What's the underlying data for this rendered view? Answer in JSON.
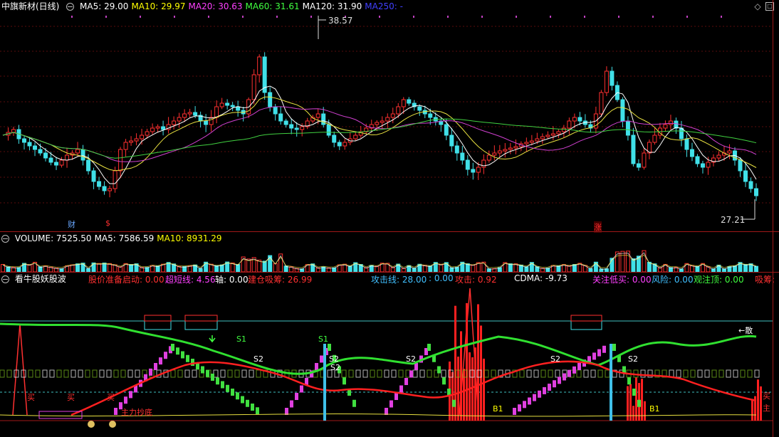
{
  "price_panel": {
    "title": "中旗新材(日线)",
    "ma_labels": [
      {
        "text": "MA5: 29.00",
        "color": "#ffffff"
      },
      {
        "text": "MA10: 29.97",
        "color": "#ffff00"
      },
      {
        "text": "MA20: 30.63",
        "color": "#ff40ff"
      },
      {
        "text": "MA60: 31.61",
        "color": "#40ff40"
      },
      {
        "text": "MA120: 31.90",
        "color": "#ffffff"
      },
      {
        "text": "MA250: -",
        "color": "#4040ff"
      }
    ],
    "high_label": "38.57",
    "low_label": "27.21",
    "markers": [
      {
        "text": "财",
        "color": "#6aa8ff"
      },
      {
        "text": "$",
        "color": "#ff3030"
      },
      {
        "text": "涨",
        "color": "#ff3030"
      }
    ]
  },
  "volume_panel": {
    "labels": [
      {
        "text": "VOLUME: 7525.50",
        "color": "#ffffff"
      },
      {
        "text": "MA5: 7586.59",
        "color": "#ffffff"
      },
      {
        "text": "MA10: 8931.29",
        "color": "#ffff00"
      }
    ]
  },
  "indicator_panel": {
    "title": "看牛股妖股波",
    "labels": [
      {
        "text": "股价准备启动: 0.00",
        "color": "#ff3030"
      },
      {
        "text": "超短线: 4.56",
        "color": "#ff40ff"
      },
      {
        "text": "轴: 0.00",
        "color": "#ffffff"
      },
      {
        "text": "建仓吸筹: 26.99",
        "color": "#ff3030"
      },
      {
        "text": "攻击线: 28.00",
        "color": "#40c0ff"
      },
      {
        "text": ": 0.00",
        "color": "#40c0ff"
      },
      {
        "text": "攻击: 0.92",
        "color": "#ff3030"
      },
      {
        "text": "CDMA: -9.73",
        "color": "#ffffff"
      },
      {
        "text": "关注低买: 0.00",
        "color": "#ff40ff"
      },
      {
        "text": "风险: 0.00",
        "color": "#40c0ff"
      },
      {
        "text": "观注顶: 0.00",
        "color": "#40ff40"
      },
      {
        "text": "吸筹:",
        "color": "#ff3030"
      }
    ],
    "chart_annotations": [
      {
        "text": "S1",
        "color": "#40ff40"
      },
      {
        "text": "S1",
        "color": "#40ff40"
      },
      {
        "text": "S2",
        "color": "#ffffff"
      },
      {
        "text": "S2",
        "color": "#ffffff"
      },
      {
        "text": "S2",
        "color": "#ffffff"
      },
      {
        "text": "S2",
        "color": "#ffffff"
      },
      {
        "text": "S2",
        "color": "#ffffff"
      },
      {
        "text": "S2",
        "color": "#ffffff"
      },
      {
        "text": "B1",
        "color": "#ffff00"
      },
      {
        "text": "B1",
        "color": "#ffff00"
      },
      {
        "text": "←散",
        "color": "#ffffff"
      },
      {
        "text": "买",
        "color": "#ff3030"
      },
      {
        "text": "主",
        "color": "#ff3030"
      },
      {
        "text": "买",
        "color": "#ff3030"
      },
      {
        "text": "买",
        "color": "#ff3030"
      },
      {
        "text": "买",
        "color": "#ff3030"
      },
      {
        "text": "主力抄底",
        "color": "#ff3030"
      }
    ]
  },
  "icons": {
    "diamond": "diamond-icon",
    "expand": "maximize-icon"
  }
}
